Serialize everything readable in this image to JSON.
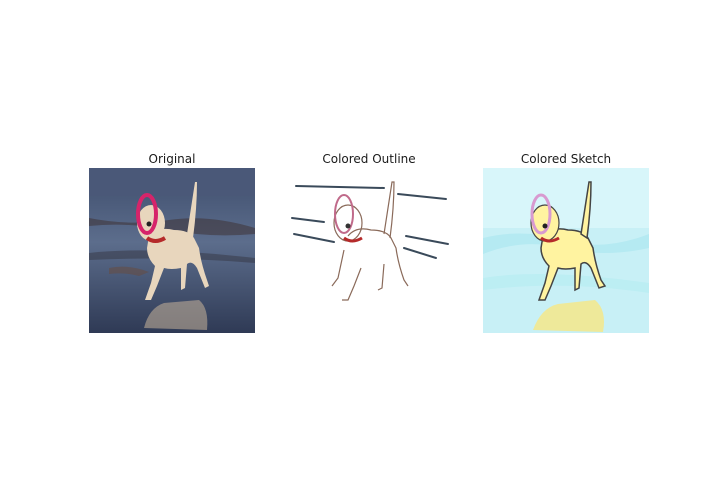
{
  "panels": [
    {
      "title": "Original"
    },
    {
      "title": "Colored Outline"
    },
    {
      "title": "Colored Sketch"
    }
  ],
  "icons": [
    "dog-photo",
    "dog-outline-drawing",
    "dog-colored-sketch"
  ]
}
